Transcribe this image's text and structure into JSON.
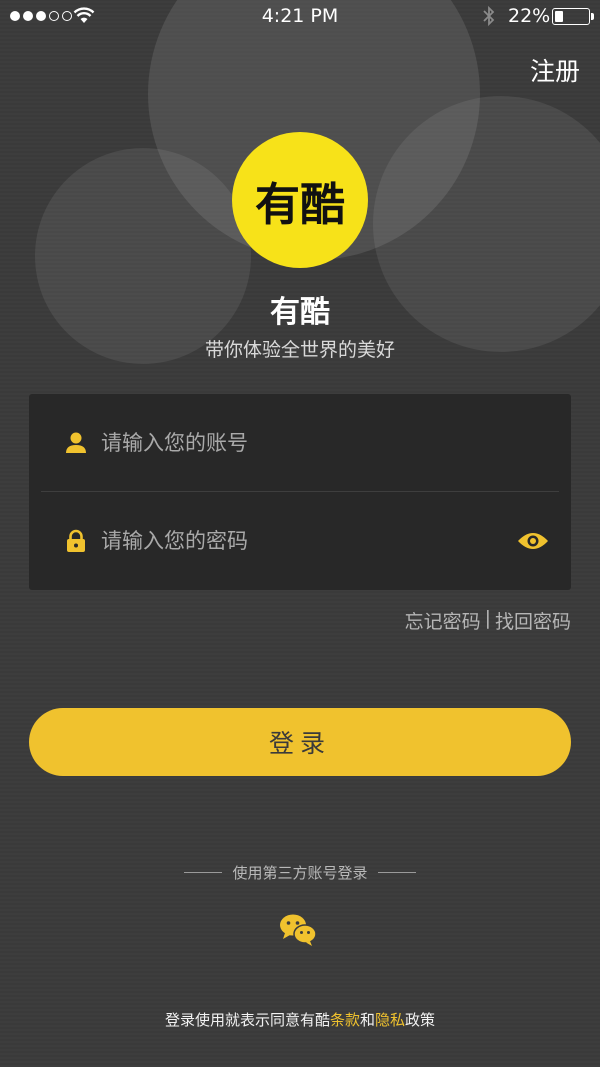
{
  "status_bar": {
    "time": "4:21 PM",
    "battery_percent": "22%",
    "battery_level": 0.22,
    "signal_bars_filled": 3,
    "signal_bars_total": 5
  },
  "header": {
    "register_label": "注册"
  },
  "logo": {
    "text": "有酷",
    "color": "#f7e219"
  },
  "app": {
    "name": "有酷",
    "slogan": "带你体验全世界的美好"
  },
  "form": {
    "account": {
      "placeholder": "请输入您的账号",
      "value": ""
    },
    "password": {
      "placeholder": "请输入您的密码",
      "value": ""
    }
  },
  "links": {
    "forgot_password": "忘记密码",
    "separator": "|",
    "recover_password": "找回密码"
  },
  "login_button": {
    "label": "登录"
  },
  "third_party": {
    "label": "使用第三方账号登录",
    "providers": [
      "wechat-icon"
    ]
  },
  "agreement": {
    "prefix": "登录使用就表示同意有酷",
    "terms": "条款",
    "and": "和",
    "privacy": "隐私",
    "suffix": "政策"
  },
  "colors": {
    "accent": "#f0c22e",
    "background": "#3c3c3c",
    "card": "#282828"
  }
}
